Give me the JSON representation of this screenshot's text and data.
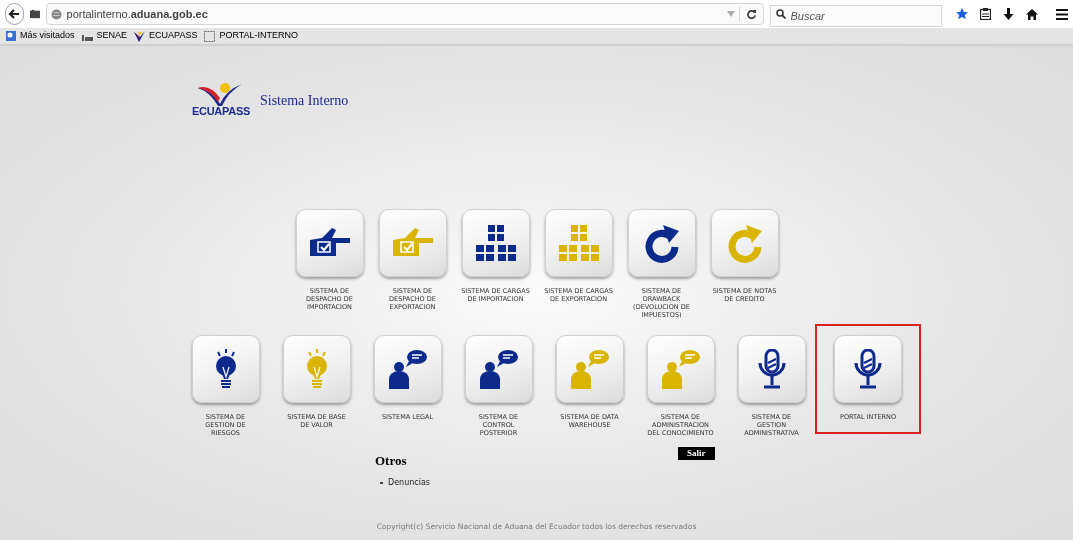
{
  "browser": {
    "url": "portalinterno.**aduana.gob.ec**",
    "search_placeholder": "Buscar",
    "bookmarks": [
      {
        "label": "Más visitados",
        "kind": "visited"
      },
      {
        "label": "SENAE",
        "kind": "senae"
      },
      {
        "label": "ECUAPASS",
        "kind": "ecuapass"
      },
      {
        "label": "PORTAL-INTERNO",
        "kind": "page"
      }
    ]
  },
  "header": {
    "brand": "ECUAPASS",
    "title": "Sistema Interno"
  },
  "system_rows": [
    [
      {
        "label": "SISTEMA DE DESPACHO DE IMPORTACION",
        "kind": "hand",
        "color": "#0b2a8c",
        "highlighted": false
      },
      {
        "label": "SISTEMA DE DESPACHO DE EXPORTACION",
        "kind": "hand",
        "color": "#d9b400",
        "highlighted": false
      },
      {
        "label": "SISTEMA DE CARGAS DE IMPORTACION",
        "kind": "blocks",
        "color": "#0b2a8c",
        "highlighted": false
      },
      {
        "label": "SISTEMA DE CARGAS DE EXPORTACION",
        "kind": "blocks",
        "color": "#d9b400",
        "highlighted": false
      },
      {
        "label": "SISTEMA DE DRAWBACK (DEVOLUCION DE IMPUESTOS)",
        "kind": "refresh",
        "color": "#0b2a8c",
        "highlighted": false
      },
      {
        "label": "SISTEMA DE NOTAS DE CREDITO",
        "kind": "refresh",
        "color": "#d9b400",
        "highlighted": false
      }
    ],
    [
      {
        "label": "SISTEMA DE GESTION DE RIESGOS",
        "kind": "bulb",
        "color": "#0b2a8c",
        "highlighted": false
      },
      {
        "label": "SISTEMA DE BASE DE VALOR",
        "kind": "bulb",
        "color": "#d9b400",
        "highlighted": false
      },
      {
        "label": "SISTEMA LEGAL",
        "kind": "person",
        "color": "#0b2a8c",
        "highlighted": false
      },
      {
        "label": "SISTEMA DE CONTROL POSTERIOR",
        "kind": "person",
        "color": "#0b2a8c",
        "highlighted": false
      },
      {
        "label": "SISTEMA DE DATA WAREHOUSE",
        "kind": "person",
        "color": "#d9b400",
        "highlighted": false
      },
      {
        "label": "SISTEMA DE ADMINISTRACION DEL CONOCIMIENTO",
        "kind": "person",
        "color": "#d9b400",
        "highlighted": false
      },
      {
        "label": "SISTEMA DE GESTION ADMINISTRATIVA",
        "kind": "mic",
        "color": "#0b2a8c",
        "highlighted": false
      },
      {
        "label": "PORTAL INTERNO",
        "kind": "mic",
        "color": "#0b2a8c",
        "highlighted": true
      }
    ]
  ],
  "others": {
    "heading": "Otros",
    "links": [
      "Denuncias"
    ]
  },
  "logout_button": "Salir",
  "copyright": "Copyright(c) Servicio Nacional de Aduana del Ecuador todos los derechos reservados"
}
